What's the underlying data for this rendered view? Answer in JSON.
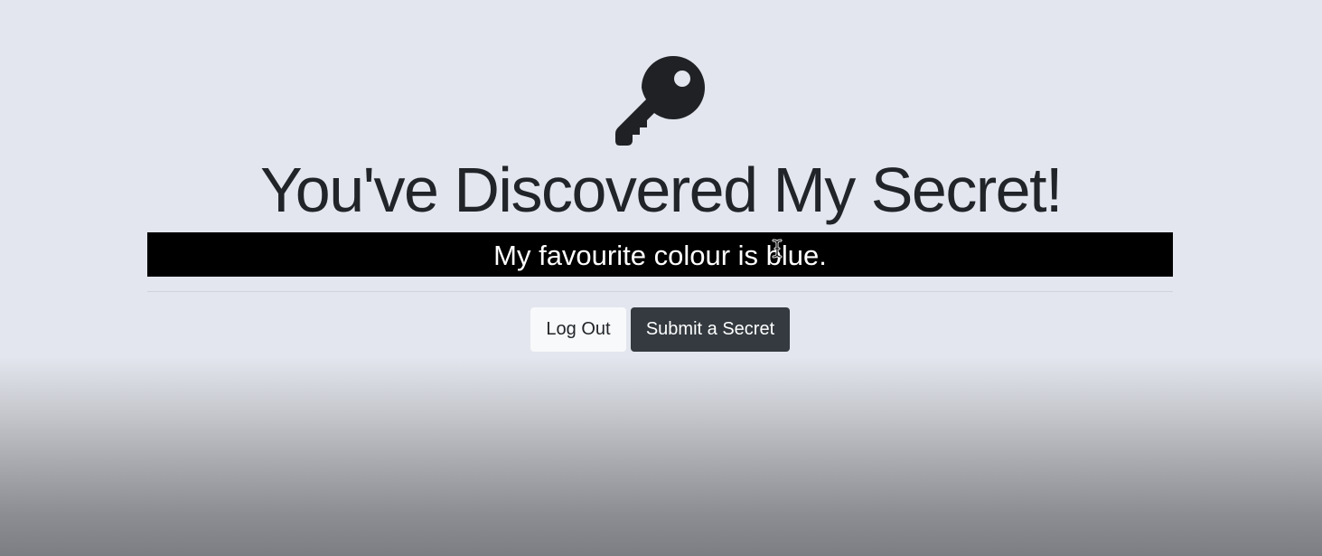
{
  "page": {
    "title": "You've Discovered My Secret!",
    "secret_text": "My favourite colour is blue."
  },
  "icons": {
    "hero": "key-icon",
    "pointer": "text-cursor-icon"
  },
  "buttons": {
    "logout_label": "Log Out",
    "submit_label": "Submit a Secret"
  },
  "colors": {
    "secret_background": "#000000",
    "secret_text": "#ffffff",
    "submit_button": "#343a40",
    "logout_button": "#f8f9fa",
    "title_text": "#212529"
  }
}
